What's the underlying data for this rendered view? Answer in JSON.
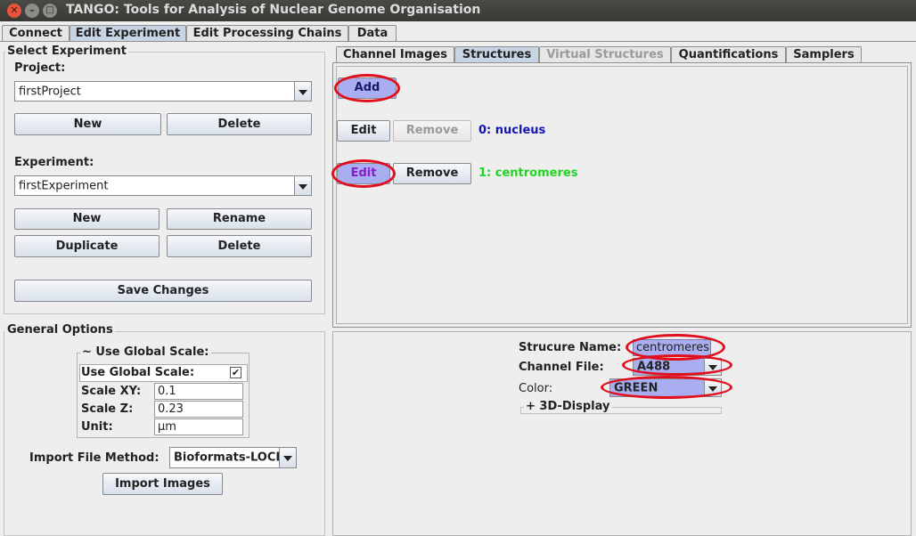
{
  "window": {
    "title": "TANGO: Tools for Analysis of Nuclear Genome Organisation",
    "close_glyph": "✕",
    "minimize_glyph": "–",
    "maximize_glyph": "□"
  },
  "main_tabs": [
    "Connect",
    "Edit Experiment",
    "Edit Processing Chains",
    "Data"
  ],
  "select_experiment": {
    "title": "Select Experiment",
    "project_label": "Project:",
    "project_value": "firstProject",
    "project_new": "New",
    "project_delete": "Delete",
    "experiment_label": "Experiment:",
    "experiment_value": "firstExperiment",
    "exp_new": "New",
    "exp_rename": "Rename",
    "exp_duplicate": "Duplicate",
    "exp_delete": "Delete",
    "save_changes": "Save Changes"
  },
  "general_options": {
    "title": "General Options",
    "global_scale_title": "~ Use Global Scale:",
    "use_global_scale_label": "Use Global Scale:",
    "use_global_scale_checked": true,
    "check_glyph": "✔",
    "scale_xy_label": "Scale XY:",
    "scale_xy_value": "0.1",
    "scale_z_label": "Scale Z:",
    "scale_z_value": "0.23",
    "unit_label": "Unit:",
    "unit_value": "µm",
    "import_method_label": "Import File Method:",
    "import_method_value": "Bioformats-LOCI",
    "import_images": "Import Images"
  },
  "sub_tabs": [
    "Channel Images",
    "Structures",
    "Virtual Structures",
    "Quantifications",
    "Samplers"
  ],
  "structures": {
    "add": "Add",
    "rows": [
      {
        "edit": "Edit",
        "remove": "Remove",
        "name": "0: nucleus",
        "color": "#1414b4"
      },
      {
        "edit": "Edit",
        "remove": "Remove",
        "name": "1: centromeres",
        "color": "#22d422"
      }
    ]
  },
  "structure_props": {
    "name_label": "Strucure Name:",
    "name_value": "centromeres",
    "channel_label": "Channel File:",
    "channel_value": "A488",
    "color_label": "Color:",
    "color_value": "GREEN",
    "display_3d": "+ 3D-Display"
  },
  "colors": {
    "highlight": "#e0101e",
    "selected_tab": "#c7d4e4",
    "field_highlight": "#a8aef0"
  }
}
